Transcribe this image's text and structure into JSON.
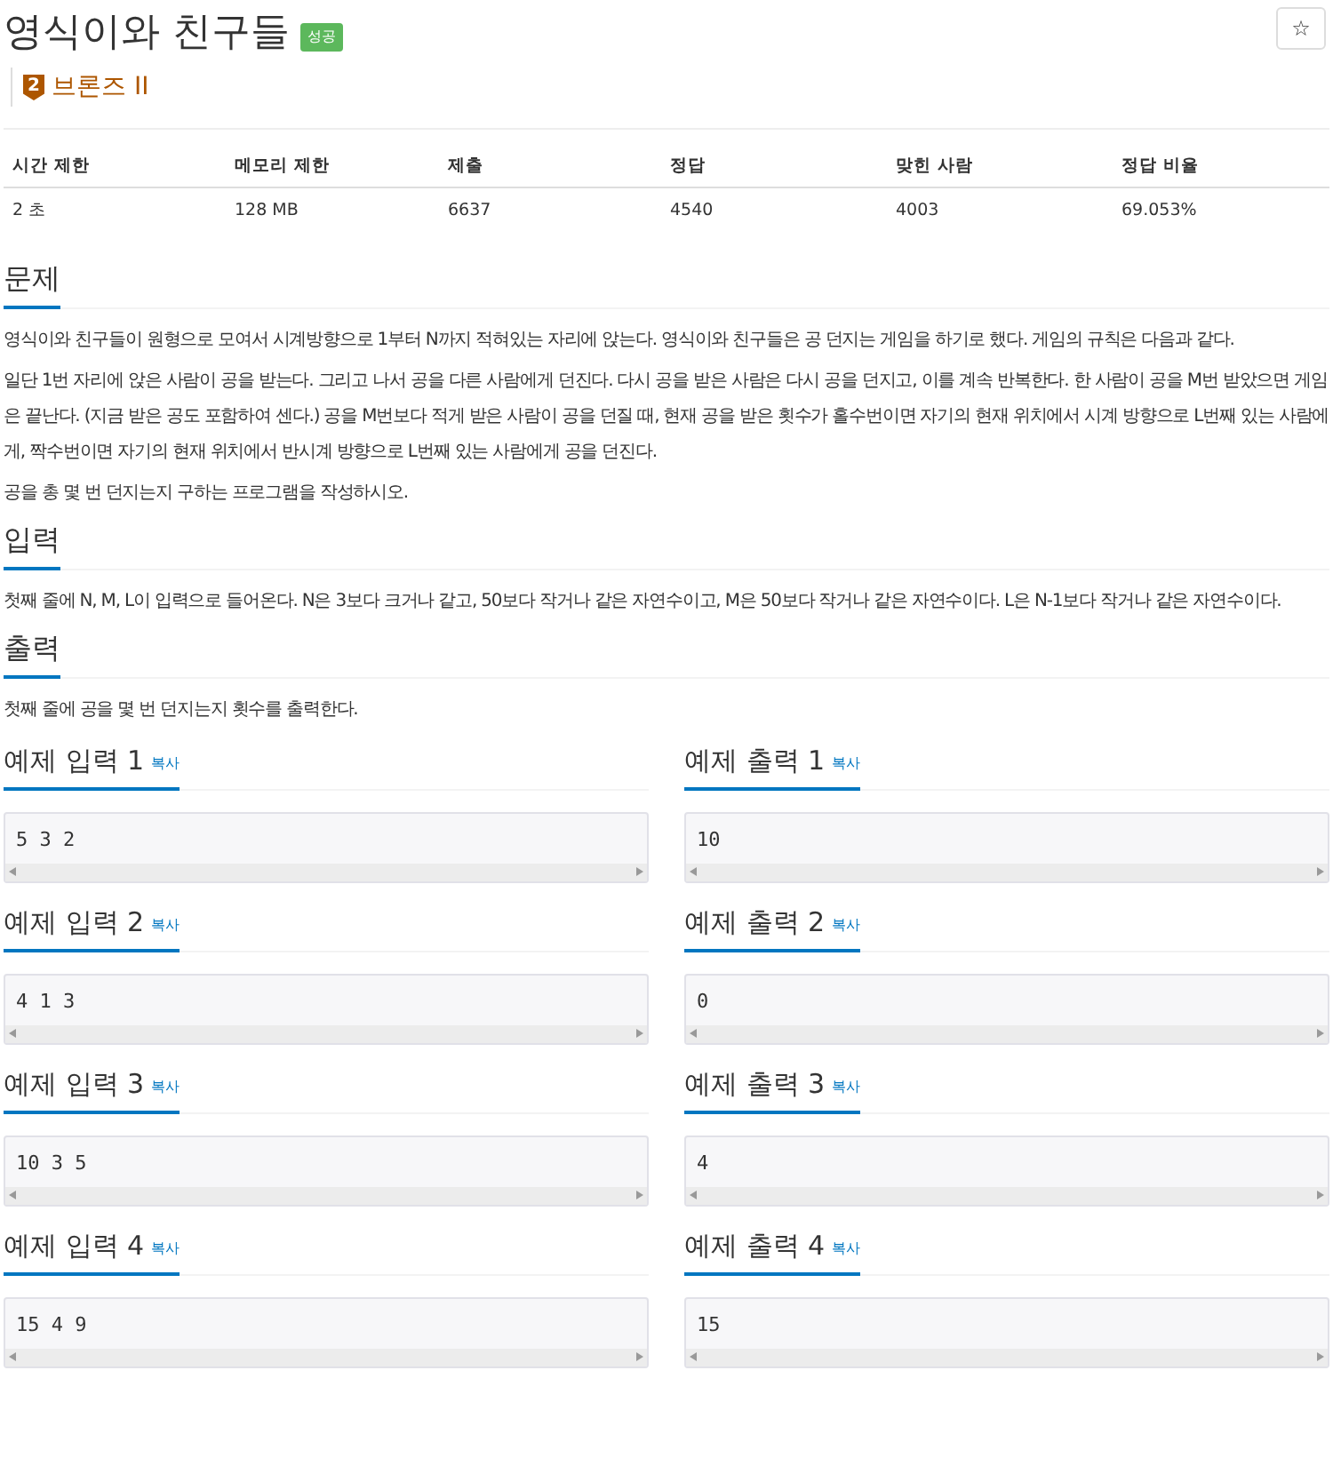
{
  "title": "영식이와 친구들",
  "result_badge": "성공",
  "star_button": "☆",
  "tier": {
    "level": "2",
    "name": "브론즈 II"
  },
  "stats": {
    "columns": [
      "시간 제한",
      "메모리 제한",
      "제출",
      "정답",
      "맞힌 사람",
      "정답 비율"
    ],
    "values": [
      "2 초",
      "128 MB",
      "6637",
      "4540",
      "4003",
      "69.053%"
    ]
  },
  "sections": [
    {
      "heading": "문제",
      "paragraphs": [
        "영식이와 친구들이 원형으로 모여서 시계방향으로 1부터 N까지 적혀있는 자리에 앉는다. 영식이와 친구들은 공 던지는 게임을 하기로 했다. 게임의 규칙은 다음과 같다.",
        "일단 1번 자리에 앉은 사람이 공을 받는다. 그리고 나서 공을 다른 사람에게 던진다. 다시 공을 받은 사람은 다시 공을 던지고, 이를 계속 반복한다. 한 사람이 공을 M번 받았으면 게임은 끝난다. (지금 받은 공도 포함하여 센다.) 공을 M번보다 적게 받은 사람이 공을 던질 때, 현재 공을 받은 횟수가 홀수번이면 자기의 현재 위치에서 시계 방향으로 L번째 있는 사람에게, 짝수번이면 자기의 현재 위치에서 반시계 방향으로 L번째 있는 사람에게 공을 던진다.",
        "공을 총 몇 번 던지는지 구하는 프로그램을 작성하시오."
      ]
    },
    {
      "heading": "입력",
      "paragraphs": [
        "첫째 줄에 N, M, L이 입력으로 들어온다. N은 3보다 크거나 같고, 50보다 작거나 같은 자연수이고, M은 50보다 작거나 같은 자연수이다. L은 N-1보다 작거나 같은 자연수이다."
      ]
    },
    {
      "heading": "출력",
      "paragraphs": [
        "첫째 줄에 공을 몇 번 던지는지 횟수를 출력한다."
      ]
    }
  ],
  "examples": [
    {
      "input": {
        "title": "예제 입력 1",
        "copy": "복사",
        "data": "5 3 2"
      },
      "output": {
        "title": "예제 출력 1",
        "copy": "복사",
        "data": "10"
      }
    },
    {
      "input": {
        "title": "예제 입력 2",
        "copy": "복사",
        "data": "4 1 3"
      },
      "output": {
        "title": "예제 출력 2",
        "copy": "복사",
        "data": "0"
      }
    },
    {
      "input": {
        "title": "예제 입력 3",
        "copy": "복사",
        "data": "10 3 5"
      },
      "output": {
        "title": "예제 출력 3",
        "copy": "복사",
        "data": "4"
      }
    },
    {
      "input": {
        "title": "예제 입력 4",
        "copy": "복사",
        "data": "15 4 9"
      },
      "output": {
        "title": "예제 출력 4",
        "copy": "복사",
        "data": "15"
      }
    }
  ]
}
